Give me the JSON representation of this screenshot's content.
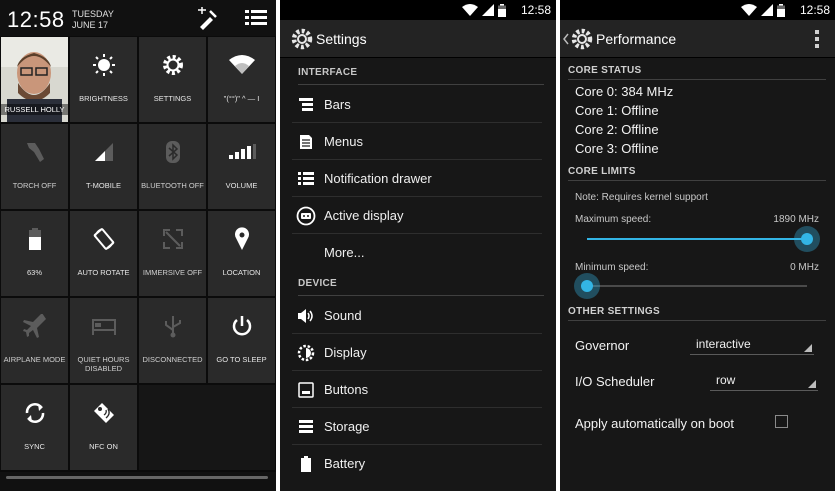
{
  "quick_settings": {
    "time": "12:58",
    "day": "TUESDAY",
    "date": "JUNE 17",
    "tiles": [
      {
        "label": "RUSSELL HOLLY",
        "icon": "user-avatar"
      },
      {
        "label": "BRIGHTNESS",
        "icon": "brightness-icon"
      },
      {
        "label": "SETTINGS",
        "icon": "settings-gear-icon"
      },
      {
        "label": "\"(°°)\" ^ — I",
        "icon": "wifi-icon"
      },
      {
        "label": "TORCH OFF",
        "icon": "torch-icon"
      },
      {
        "label": "T-MOBILE",
        "icon": "signal-icon"
      },
      {
        "label": "BLUETOOTH OFF",
        "icon": "bluetooth-icon"
      },
      {
        "label": "VOLUME",
        "icon": "volume-icon"
      },
      {
        "label": "63%",
        "icon": "battery-icon"
      },
      {
        "label": "AUTO ROTATE",
        "icon": "auto-rotate-icon"
      },
      {
        "label": "IMMERSIVE OFF",
        "icon": "immersive-icon"
      },
      {
        "label": "LOCATION",
        "icon": "location-icon"
      },
      {
        "label": "AIRPLANE MODE",
        "icon": "airplane-icon"
      },
      {
        "label": "QUIET HOURS DISABLED",
        "icon": "quiet-hours-icon"
      },
      {
        "label": "DISCONNECTED",
        "icon": "usb-icon"
      },
      {
        "label": "GO TO SLEEP",
        "icon": "power-icon"
      },
      {
        "label": "SYNC",
        "icon": "sync-icon"
      },
      {
        "label": "NFC ON",
        "icon": "nfc-icon"
      }
    ]
  },
  "settings_screen": {
    "status_time": "12:58",
    "title": "Settings",
    "sections": {
      "interface": "INTERFACE",
      "device": "DEVICE"
    },
    "interface_items": [
      "Bars",
      "Menus",
      "Notification drawer",
      "Active display",
      "More..."
    ],
    "device_items": [
      "Sound",
      "Display",
      "Buttons",
      "Storage",
      "Battery"
    ]
  },
  "performance_screen": {
    "status_time": "12:58",
    "title": "Performance",
    "core_status_header": "CORE STATUS",
    "cores": [
      "Core 0: 384 MHz",
      "Core 1: Offline",
      "Core 2: Offline",
      "Core 3: Offline"
    ],
    "core_limits_header": "CORE LIMITS",
    "note": "Note: Requires kernel support",
    "max_speed": {
      "label": "Maximum speed:",
      "value": "1890 MHz",
      "level": 1.0
    },
    "min_speed": {
      "label": "Minimum speed:",
      "value": "0 MHz",
      "level": 0.0
    },
    "other_settings_header": "OTHER SETTINGS",
    "governor": {
      "label": "Governor",
      "value": "interactive"
    },
    "io_scheduler": {
      "label": "I/O Scheduler",
      "value": "row"
    },
    "apply_on_boot": {
      "label": "Apply automatically on boot",
      "checked": false
    }
  },
  "colors": {
    "accent": "#33b5e5",
    "background": "#171717",
    "tile": "#2a2a2a"
  }
}
